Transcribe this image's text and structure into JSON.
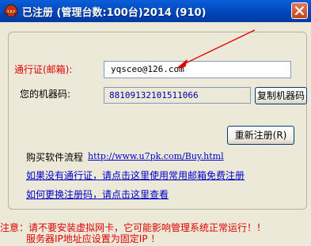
{
  "window": {
    "title": "已注册 (管理台数:100台)2014 (910)",
    "close_label": "×"
  },
  "form": {
    "email_label": "通行证(邮箱):",
    "email_value": "yqsceo@126.com",
    "machine_code_label": "您的机器码:",
    "machine_code_value": "88109132101511066",
    "copy_button_label": "复制机器码",
    "reregister_button_text": "重新注册",
    "reregister_button_hotkey": "(R)"
  },
  "links": {
    "buy_flow_label": "购买软件流程",
    "buy_url": "http://www.u7pk.com/Buy.html",
    "free_register": "如果没有通行证，请点击这里使用常用邮箱免费注册",
    "change_code": "如何更换注册码，请点击这里查看"
  },
  "warnings": {
    "line1": "注意：请不要安装虚拟网卡，它可能影响管理系统正常运行！！",
    "line2": "服务器IP地址应设置为固定IP ！"
  },
  "colors": {
    "titlebar": "#0050c8",
    "warning_text": "#e00000",
    "link_text": "#0000cc",
    "annotation_arrow": "#e00000"
  },
  "icons": {
    "app": "helmet-icon",
    "close": "close-icon"
  }
}
